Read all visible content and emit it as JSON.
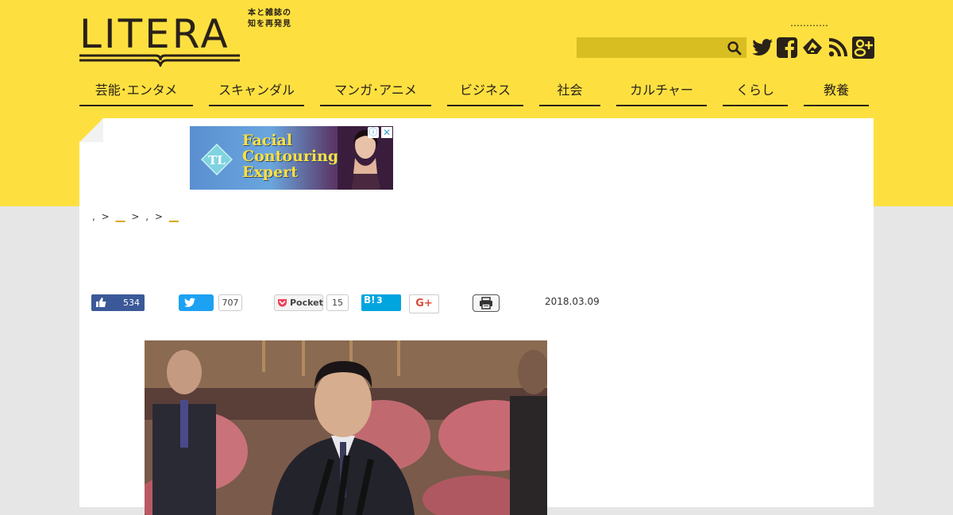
{
  "header": {
    "logo_text": "LITERA",
    "logo_tagline_1": "本と雑誌の",
    "logo_tagline_2": "知を再発見",
    "dots": "…………",
    "search_placeholder": ""
  },
  "social_icons": [
    "twitter-icon",
    "facebook-icon",
    "feedly-icon",
    "rss-icon",
    "google-plus-icon"
  ],
  "nav": {
    "items": [
      {
        "label": "芸能･エンタメ"
      },
      {
        "label": "スキャンダル"
      },
      {
        "label": "マンガ･アニメ"
      },
      {
        "label": "ビジネス"
      },
      {
        "label": "社会"
      },
      {
        "label": "カルチャー"
      },
      {
        "label": "くらし"
      },
      {
        "label": "教養"
      }
    ]
  },
  "ad": {
    "line1": "Facial",
    "line2": "Contouring",
    "line3": "Expert",
    "info_glyph": "ⓘ",
    "close_glyph": "✕"
  },
  "breadcrumb": {
    "sep": ">",
    "item1": ",",
    "item2": "__",
    "item3": ",",
    "item4": "__"
  },
  "share": {
    "like_count": "534",
    "tweet_count": "707",
    "pocket_label": "Pocket",
    "pocket_count": "15",
    "hatena_label": "B!",
    "hatena_count": "3",
    "gplus_label": "G+"
  },
  "article": {
    "date": "2018.03.09"
  },
  "colors": {
    "brand_yellow": "#fde040",
    "nav_text": "#2a2119",
    "link": "#d4a500",
    "facebook": "#3b5998",
    "twitter": "#1da1f2",
    "hatena": "#00a4de"
  }
}
